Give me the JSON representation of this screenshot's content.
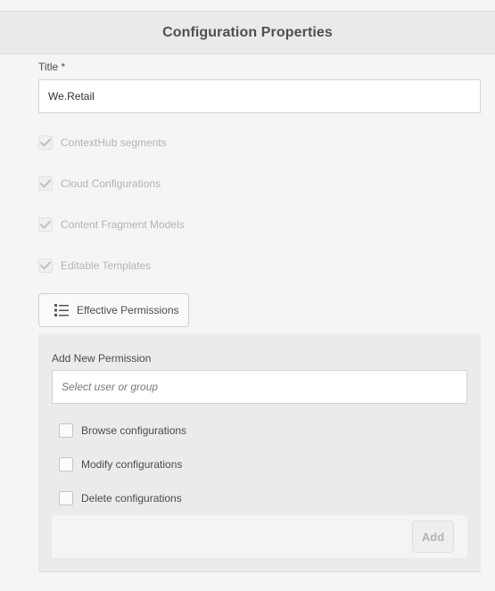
{
  "dialog": {
    "title": "Configuration Properties"
  },
  "title_field": {
    "label": "Title *",
    "value": "We.Retail"
  },
  "features": [
    {
      "label": "ContextHub segments",
      "checked": true,
      "disabled": true
    },
    {
      "label": "Cloud Configurations",
      "checked": true,
      "disabled": true
    },
    {
      "label": "Content Fragment Models",
      "checked": true,
      "disabled": true
    },
    {
      "label": "Editable Templates",
      "checked": true,
      "disabled": true
    }
  ],
  "effective_permissions": {
    "label": "Effective Permissions",
    "icon": "list-icon"
  },
  "add_permission": {
    "label": "Add New Permission",
    "placeholder": "Select user or group",
    "options": [
      {
        "label": "Browse configurations",
        "checked": false
      },
      {
        "label": "Modify configurations",
        "checked": false
      },
      {
        "label": "Delete configurations",
        "checked": false
      }
    ],
    "add_label": "Add"
  }
}
